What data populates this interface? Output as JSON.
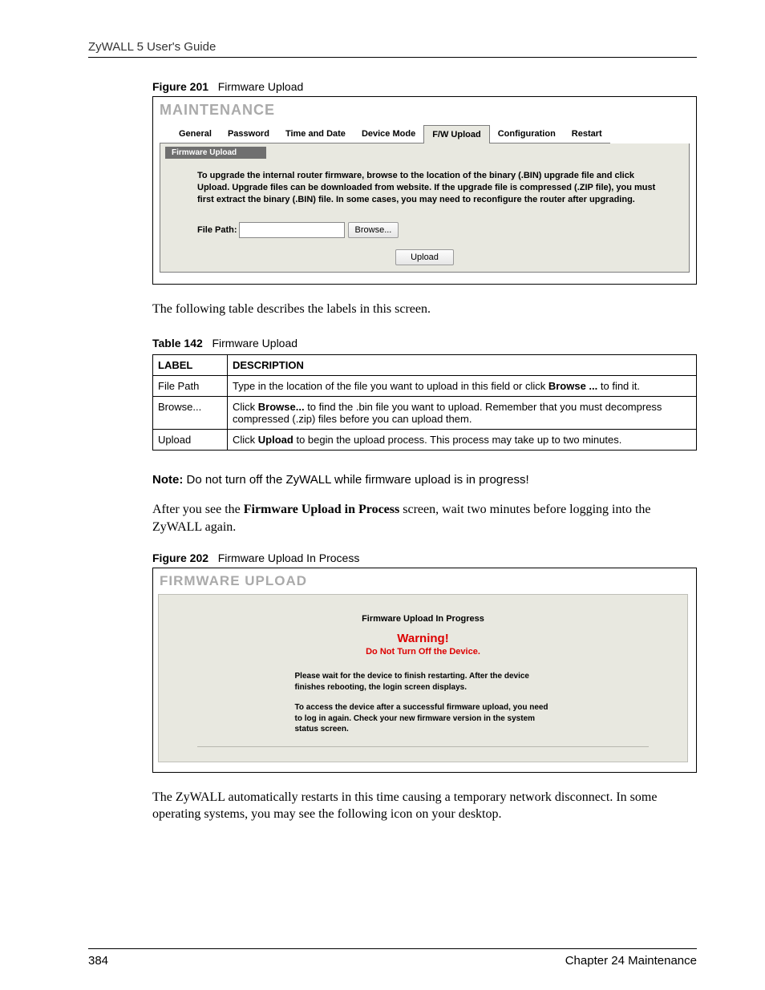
{
  "header": {
    "running": "ZyWALL 5 User's Guide"
  },
  "figure201": {
    "caption_num": "Figure 201",
    "caption_text": "Firmware Upload",
    "title": "MAINTENANCE",
    "tabs": [
      "General",
      "Password",
      "Time and Date",
      "Device Mode",
      "F/W Upload",
      "Configuration",
      "Restart"
    ],
    "section": "Firmware Upload",
    "instructions": "To upgrade the internal router firmware, browse to the location of the binary (.BIN) upgrade file and click Upload. Upgrade files can be downloaded from website. If the upgrade file is compressed (.ZIP file), you must first extract the binary (.BIN) file. In some cases, you may need to reconfigure the router after upgrading.",
    "file_label": "File Path:",
    "browse_btn": "Browse...",
    "upload_btn": "Upload"
  },
  "intro_text": "The following table describes the labels in this screen.",
  "table142": {
    "caption_num": "Table 142",
    "caption_text": "Firmware Upload",
    "headers": [
      "LABEL",
      "DESCRIPTION"
    ],
    "rows": [
      {
        "label": "File Path",
        "desc_pre": "Type in the location of the file you want to upload in this field or click ",
        "desc_bold": "Browse ...",
        "desc_post": " to find it."
      },
      {
        "label": "Browse...",
        "desc_pre": "Click ",
        "desc_bold": "Browse...",
        "desc_post": " to find the .bin file you want to upload. Remember that you must decompress compressed (.zip) files before you can upload them."
      },
      {
        "label": "Upload",
        "desc_pre": "Click ",
        "desc_bold": "Upload",
        "desc_post": " to begin the upload process. This process may take up to two minutes."
      }
    ]
  },
  "note": {
    "label": "Note:",
    "text": "Do not turn off the ZyWALL while firmware upload is in progress!"
  },
  "after_text_pre": "After you see the ",
  "after_text_bold": "Firmware Upload in Process",
  "after_text_post": " screen, wait two minutes before logging into the ZyWALL again.",
  "figure202": {
    "caption_num": "Figure 202",
    "caption_text": "Firmware Upload In Process",
    "title": "FIRMWARE UPLOAD",
    "progress": "Firmware Upload In Progress",
    "warning": "Warning!",
    "warning_sub": "Do Not Turn Off the Device.",
    "msg1": "Please wait for the device to finish restarting. After the device finishes rebooting, the login screen displays.",
    "msg2": "To access the device after a successful firmware upload, you need to log in again. Check your new firmware version in the system status screen."
  },
  "closing_text": "The ZyWALL automatically restarts in this time causing a temporary network disconnect. In some operating systems, you may see the following icon on your desktop.",
  "footer": {
    "page": "384",
    "chapter": "Chapter 24 Maintenance"
  }
}
